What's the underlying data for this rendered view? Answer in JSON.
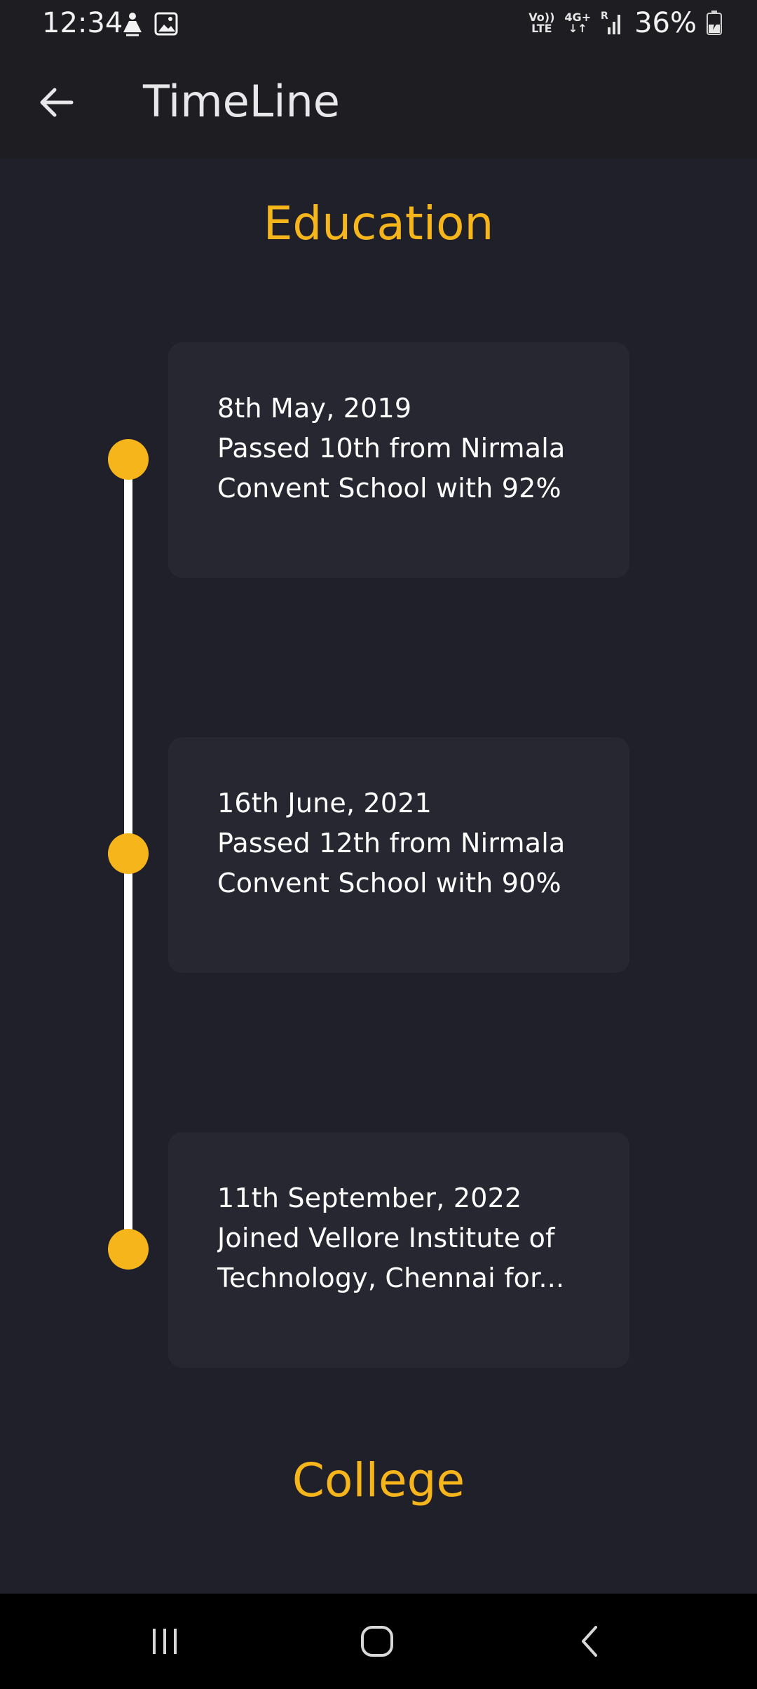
{
  "status_bar": {
    "time": "12:34",
    "battery": "36%",
    "net_volte": "Vo))\nLTE",
    "net_4g": "4G+",
    "net_r": "R",
    "icons": [
      "silent-person-icon",
      "gallery-icon",
      "signal-icon",
      "battery-charging-icon"
    ]
  },
  "app_bar": {
    "title": "TimeLine",
    "back_icon": "arrow-left-icon"
  },
  "sections": [
    {
      "heading": "Education"
    },
    {
      "heading": "College"
    }
  ],
  "timeline": [
    {
      "date": "8th May, 2019",
      "line1": "Passed 10th from Nirmala",
      "line2": "Convent School with 92%"
    },
    {
      "date": "16th June, 2021",
      "line1": "Passed 12th from Nirmala",
      "line2": "Convent School with 90%"
    },
    {
      "date": "11th September, 2022",
      "line1": "Joined Vellore Institute of",
      "line2": "Technology, Chennai for..."
    }
  ],
  "colors": {
    "accent": "#f6b51b",
    "background": "#20202a",
    "card": "#272731",
    "app_bar": "#1e1e22"
  },
  "nav_bar": {
    "icons": [
      "recent-apps-icon",
      "home-icon",
      "back-icon"
    ]
  }
}
